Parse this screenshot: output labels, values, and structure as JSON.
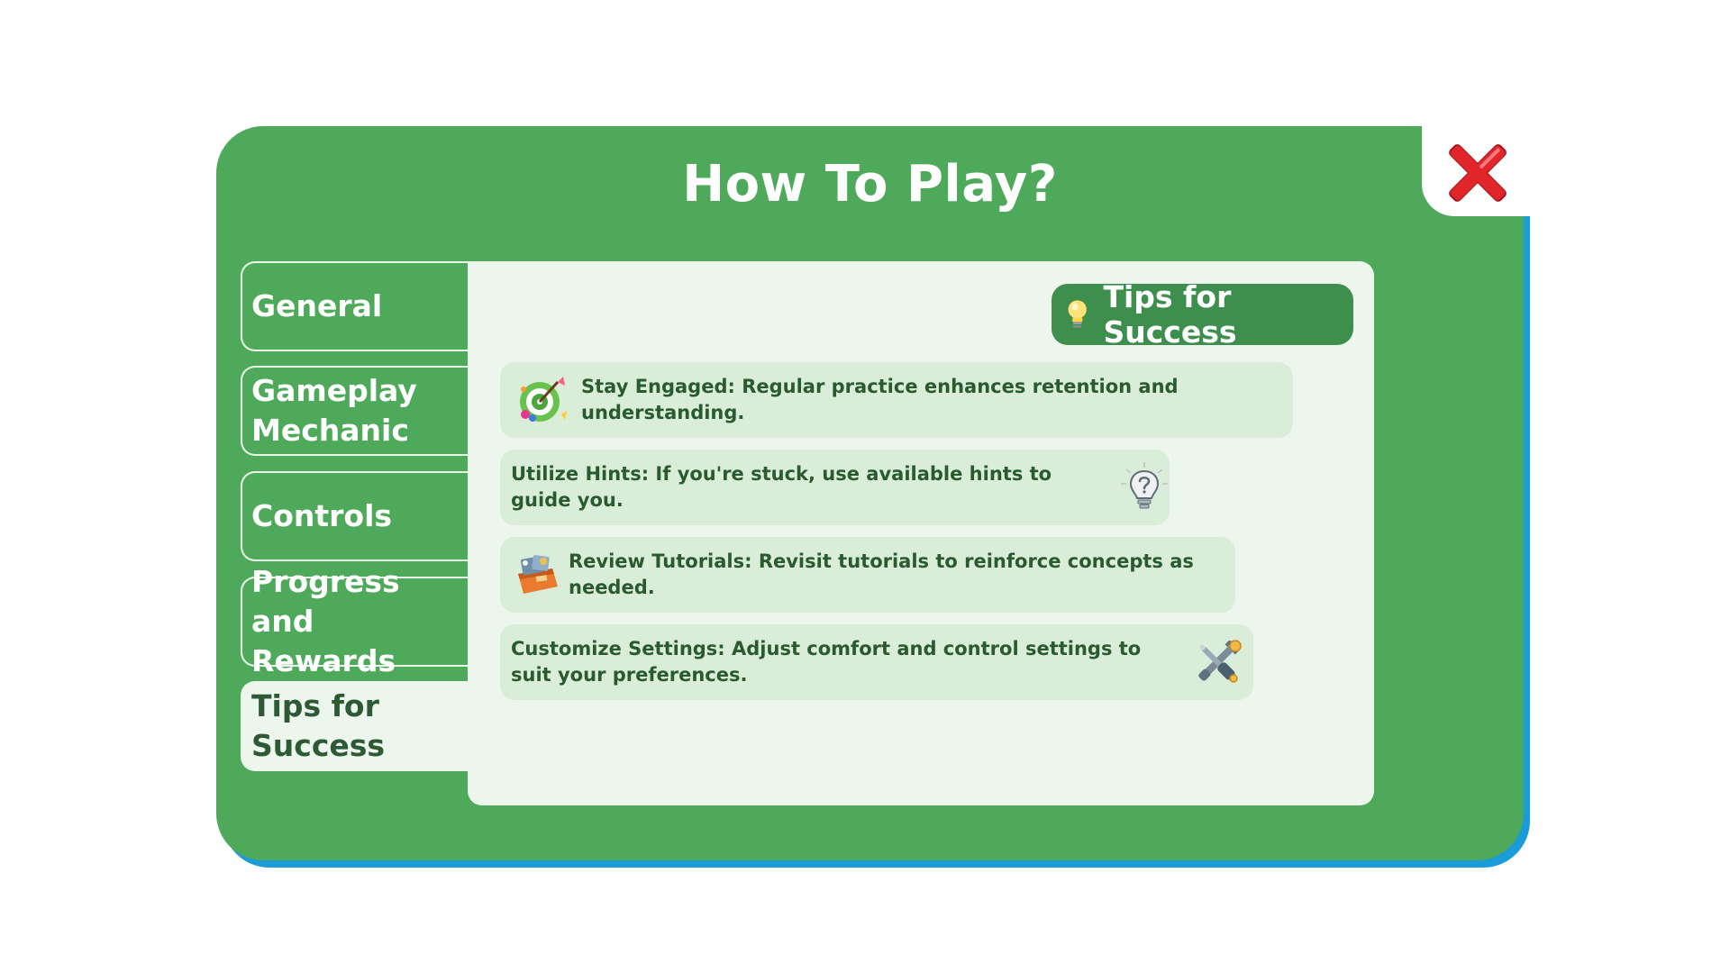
{
  "dialog": {
    "title": "How To Play?"
  },
  "tabs": [
    {
      "label": "General",
      "active": false
    },
    {
      "label": "Gameplay Mechanic",
      "active": false
    },
    {
      "label": "Controls",
      "active": false
    },
    {
      "label": "Progress and Rewards",
      "active": false
    },
    {
      "label": "Tips for Success",
      "active": true
    }
  ],
  "content": {
    "header": {
      "label": "Tips for Success",
      "icon": "lightbulb-icon"
    },
    "tips": [
      {
        "text": "Stay Engaged: Regular practice enhances retention and understanding.",
        "icon": "target-icon"
      },
      {
        "text": "Utilize Hints: If you're stuck, use available hints to guide you.",
        "icon": "hint-bulb-icon"
      },
      {
        "text": "Review Tutorials: Revisit tutorials to reinforce concepts as needed.",
        "icon": "tutorial-box-icon"
      },
      {
        "text": "Customize Settings: Adjust comfort and control settings to suit your preferences.",
        "icon": "tools-icon"
      }
    ]
  },
  "colors": {
    "panel": "#4eaa5a",
    "panel_shadow": "#1b9bd8",
    "content_bg": "#edf6ec",
    "tip_bg": "#d9edd9",
    "header_bg": "#3e8f4e",
    "text_dark": "#2a5a30",
    "close_red": "#e0262b"
  }
}
